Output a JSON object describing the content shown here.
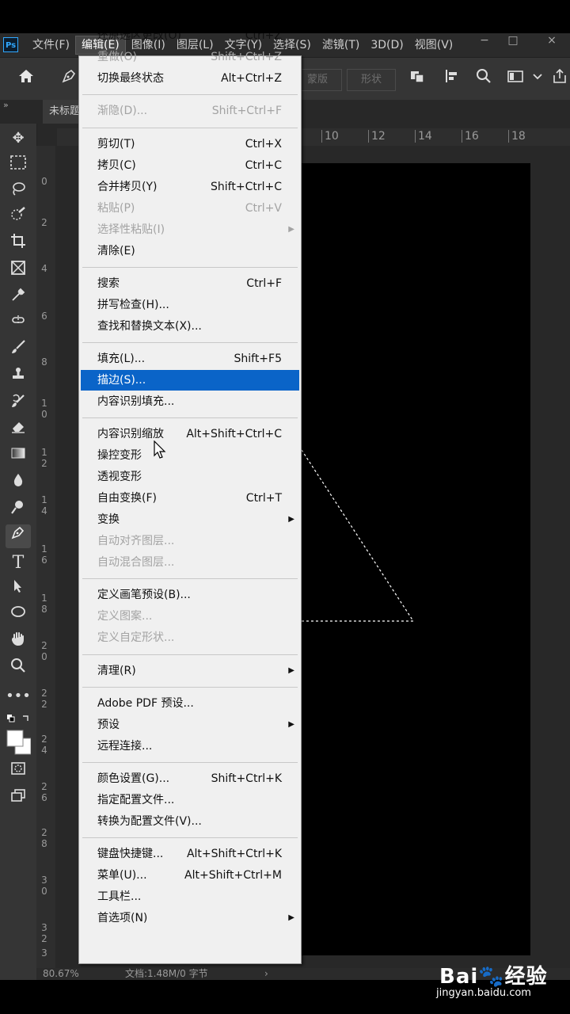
{
  "menubar": {
    "logo": "Ps",
    "items": [
      "文件(F)",
      "编辑(E)",
      "图像(I)",
      "图层(L)",
      "文字(Y)",
      "选择(S)",
      "滤镜(T)",
      "3D(D)",
      "视图(V)"
    ],
    "window_controls": [
      "−",
      "□",
      "×"
    ]
  },
  "options_bar": {
    "mode_buttons": [
      "蒙版",
      "形状"
    ]
  },
  "tab": {
    "doc_title": "未标题"
  },
  "ruler_top": [
    "10",
    "12",
    "14",
    "16",
    "18"
  ],
  "ruler_left": [
    "0",
    "2",
    "4",
    "6",
    "8",
    "1\n0",
    "1\n2",
    "1\n4",
    "1\n6",
    "1\n8",
    "2\n0",
    "2\n2",
    "2\n4",
    "2\n6",
    "2\n8",
    "3\n0",
    "3\n2",
    "3"
  ],
  "status": {
    "zoom": "80.67%",
    "doc_info": "文档:1.48M/0 字节",
    "arrow": "›"
  },
  "edit_menu": [
    {
      "label": "还原选区更改(O)",
      "shortcut": "Ctrl+Z",
      "disabled": false
    },
    {
      "label": "重做(O)",
      "shortcut": "Shift+Ctrl+Z",
      "disabled": true
    },
    {
      "label": "切换最终状态",
      "shortcut": "Alt+Ctrl+Z",
      "disabled": false
    },
    {
      "label": "渐隐(D)...",
      "shortcut": "Shift+Ctrl+F",
      "disabled": true
    },
    {
      "label": "剪切(T)",
      "shortcut": "Ctrl+X",
      "disabled": false
    },
    {
      "label": "拷贝(C)",
      "shortcut": "Ctrl+C",
      "disabled": false
    },
    {
      "label": "合并拷贝(Y)",
      "shortcut": "Shift+Ctrl+C",
      "disabled": false
    },
    {
      "label": "粘贴(P)",
      "shortcut": "Ctrl+V",
      "disabled": true
    },
    {
      "label": "选择性粘贴(I)",
      "shortcut": "",
      "disabled": true,
      "submenu": true
    },
    {
      "label": "清除(E)",
      "shortcut": "",
      "disabled": false
    },
    {
      "label": "搜索",
      "shortcut": "Ctrl+F",
      "disabled": false
    },
    {
      "label": "拼写检查(H)...",
      "shortcut": "",
      "disabled": false
    },
    {
      "label": "查找和替换文本(X)...",
      "shortcut": "",
      "disabled": false
    },
    {
      "label": "填充(L)...",
      "shortcut": "Shift+F5",
      "disabled": false
    },
    {
      "label": "描边(S)...",
      "shortcut": "",
      "disabled": false,
      "highlighted": true
    },
    {
      "label": "内容识别填充...",
      "shortcut": "",
      "disabled": false
    },
    {
      "label": "内容识别缩放",
      "shortcut": "Alt+Shift+Ctrl+C",
      "disabled": false
    },
    {
      "label": "操控变形",
      "shortcut": "",
      "disabled": false
    },
    {
      "label": "透视变形",
      "shortcut": "",
      "disabled": false
    },
    {
      "label": "自由变换(F)",
      "shortcut": "Ctrl+T",
      "disabled": false
    },
    {
      "label": "变换",
      "shortcut": "",
      "disabled": false,
      "submenu": true
    },
    {
      "label": "自动对齐图层...",
      "shortcut": "",
      "disabled": true
    },
    {
      "label": "自动混合图层...",
      "shortcut": "",
      "disabled": true
    },
    {
      "label": "定义画笔预设(B)...",
      "shortcut": "",
      "disabled": false
    },
    {
      "label": "定义图案...",
      "shortcut": "",
      "disabled": true
    },
    {
      "label": "定义自定形状...",
      "shortcut": "",
      "disabled": true
    },
    {
      "label": "清理(R)",
      "shortcut": "",
      "disabled": false,
      "submenu": true
    },
    {
      "label": "Adobe PDF 预设...",
      "shortcut": "",
      "disabled": false
    },
    {
      "label": "预设",
      "shortcut": "",
      "disabled": false,
      "submenu": true
    },
    {
      "label": "远程连接...",
      "shortcut": "",
      "disabled": false
    },
    {
      "label": "颜色设置(G)...",
      "shortcut": "Shift+Ctrl+K",
      "disabled": false
    },
    {
      "label": "指定配置文件...",
      "shortcut": "",
      "disabled": false
    },
    {
      "label": "转换为配置文件(V)...",
      "shortcut": "",
      "disabled": false
    },
    {
      "label": "键盘快捷键...",
      "shortcut": "Alt+Shift+Ctrl+K",
      "disabled": false
    },
    {
      "label": "菜单(U)...",
      "shortcut": "Alt+Shift+Ctrl+M",
      "disabled": false
    },
    {
      "label": "工具栏...",
      "shortcut": "",
      "disabled": false
    },
    {
      "label": "首选项(N)",
      "shortcut": "",
      "disabled": false,
      "submenu": true
    }
  ],
  "watermark": {
    "logo": "Bai🐾经验",
    "url": "jingyan.baidu.com"
  },
  "colors": {
    "highlight": "#0a64c8",
    "menu_bg": "#f0f0f0",
    "app_bg": "#282828"
  }
}
